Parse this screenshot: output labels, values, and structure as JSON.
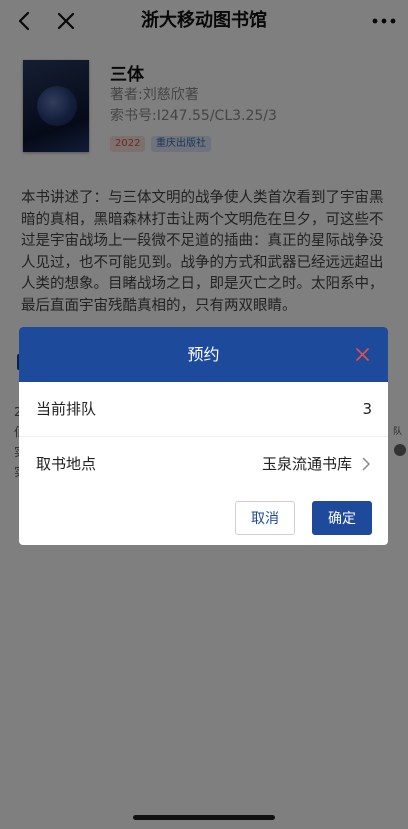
{
  "navbar": {
    "title": "浙大移动图书馆",
    "back_icon": "chevron-left-icon",
    "close_icon": "close-icon",
    "more_icon": "more-dots-icon"
  },
  "book": {
    "title": "三体",
    "author": "著者:刘慈欣著",
    "call_number": "索书号:I247.55/CL3.25/3",
    "tags": {
      "year": "2022",
      "publisher": "重庆出版社"
    },
    "description": "本书讲述了：与三体文明的战争使人类首次看到了宇宙黑暗的真相，黑暗森林打击让两个文明危在旦夕，可这些不过是宇宙战场上一段微不足道的插曲：真正的星际战争没人见过，也不可能见到。战争的方式和武器已经远远超出人类的想象。目睹战场之日，即是灭亡之时。太阳系中，最后直面宇宙残酷真相的，只有两双眼睛。"
  },
  "background": {
    "right_label": "队",
    "right_badge": "3",
    "left_chars": "2 佰 实 实"
  },
  "modal": {
    "title": "预约",
    "close_icon": "close-icon",
    "queue_label": "当前排队",
    "queue_value": "3",
    "location_label": "取书地点",
    "location_value": "玉泉流通书库",
    "cancel_label": "取消",
    "confirm_label": "确定"
  },
  "colors": {
    "primary": "#1e4a9c",
    "close_x": "#e0534a",
    "tag_year_bg": "#fbe3e1",
    "tag_publisher_bg": "#dfe9f8"
  }
}
